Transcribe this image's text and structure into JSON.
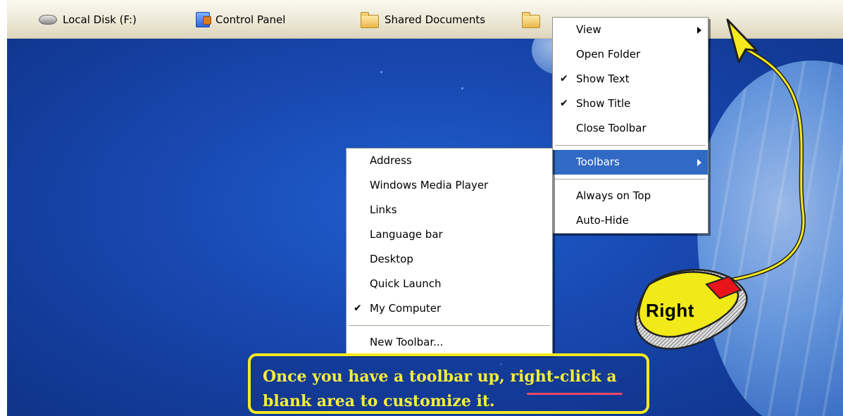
{
  "toolbar": {
    "items": [
      {
        "label": "Local Disk (F:)",
        "icon": "hard-disk-icon"
      },
      {
        "label": "Control Panel",
        "icon": "control-panel-icon"
      },
      {
        "label": "Shared Documents",
        "icon": "folder-icon"
      },
      {
        "label": "",
        "icon": "folder-icon"
      }
    ]
  },
  "context_menu": {
    "items": [
      {
        "label": "View",
        "checked": false,
        "submenu": true
      },
      {
        "label": "Open Folder",
        "checked": false,
        "submenu": false
      },
      {
        "label": "Show Text",
        "checked": true,
        "submenu": false
      },
      {
        "label": "Show Title",
        "checked": true,
        "submenu": false
      },
      {
        "label": "Close Toolbar",
        "checked": false,
        "submenu": false
      },
      {
        "label": "Toolbars",
        "checked": false,
        "submenu": true,
        "highlighted": true
      },
      {
        "label": "Always on Top",
        "checked": false,
        "submenu": false
      },
      {
        "label": "Auto-Hide",
        "checked": false,
        "submenu": false
      }
    ]
  },
  "toolbars_submenu": {
    "items": [
      {
        "label": "Address",
        "checked": false
      },
      {
        "label": "Windows Media Player",
        "checked": false
      },
      {
        "label": "Links",
        "checked": false
      },
      {
        "label": "Language bar",
        "checked": false
      },
      {
        "label": "Desktop",
        "checked": false
      },
      {
        "label": "Quick Launch",
        "checked": false
      },
      {
        "label": "My Computer",
        "checked": true
      },
      {
        "label": "New Toolbar...",
        "checked": false
      }
    ]
  },
  "check_glyph": "✔",
  "mouse_label": "Right",
  "annotation": {
    "line1_prefix": "Once you have a toolbar up, ",
    "line1_emphasis": "right-click",
    "line1_suffix": " a",
    "line2": "blank area to customize it."
  },
  "colors": {
    "menu_highlight": "#316ac5",
    "annotation_yellow": "#f4ea1f",
    "underline_pink": "#e84a6a",
    "mouse_button_red": "#e8141a"
  }
}
